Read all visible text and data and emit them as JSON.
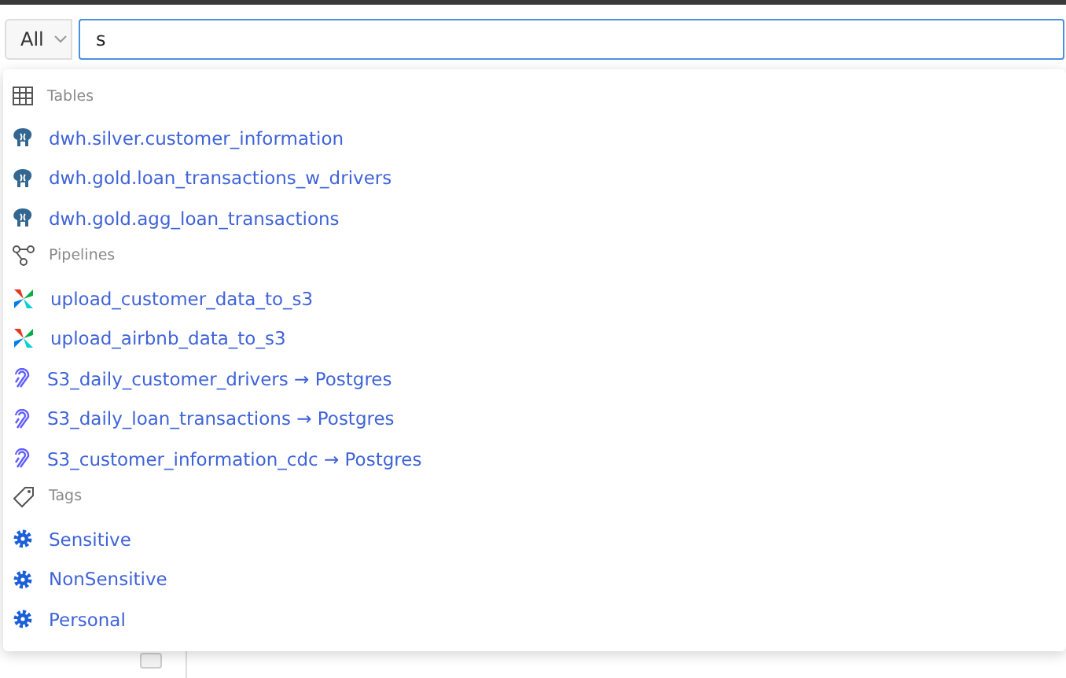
{
  "search": {
    "scope": "All",
    "value": "s"
  },
  "sections": [
    {
      "title": "Tables",
      "kind": "table",
      "items": [
        {
          "label": "dwh.silver.customer_information",
          "kind": "postgres"
        },
        {
          "label": "dwh.gold.loan_transactions_w_drivers",
          "kind": "postgres"
        },
        {
          "label": "dwh.gold.agg_loan_transactions",
          "kind": "postgres"
        }
      ]
    },
    {
      "title": "Pipelines",
      "kind": "pipeline",
      "items": [
        {
          "label": "upload_customer_data_to_s3",
          "kind": "airflow"
        },
        {
          "label": "upload_airbnb_data_to_s3",
          "kind": "airflow"
        },
        {
          "label": "S3_daily_customer_drivers → Postgres",
          "kind": "airbyte"
        },
        {
          "label": "S3_daily_loan_transactions → Postgres",
          "kind": "airbyte"
        },
        {
          "label": "S3_customer_information_cdc → Postgres",
          "kind": "airbyte"
        }
      ]
    },
    {
      "title": "Tags",
      "kind": "tag",
      "items": [
        {
          "label": "Sensitive",
          "kind": "tag"
        },
        {
          "label": "NonSensitive",
          "kind": "tag"
        },
        {
          "label": "Personal",
          "kind": "tag"
        }
      ]
    }
  ]
}
